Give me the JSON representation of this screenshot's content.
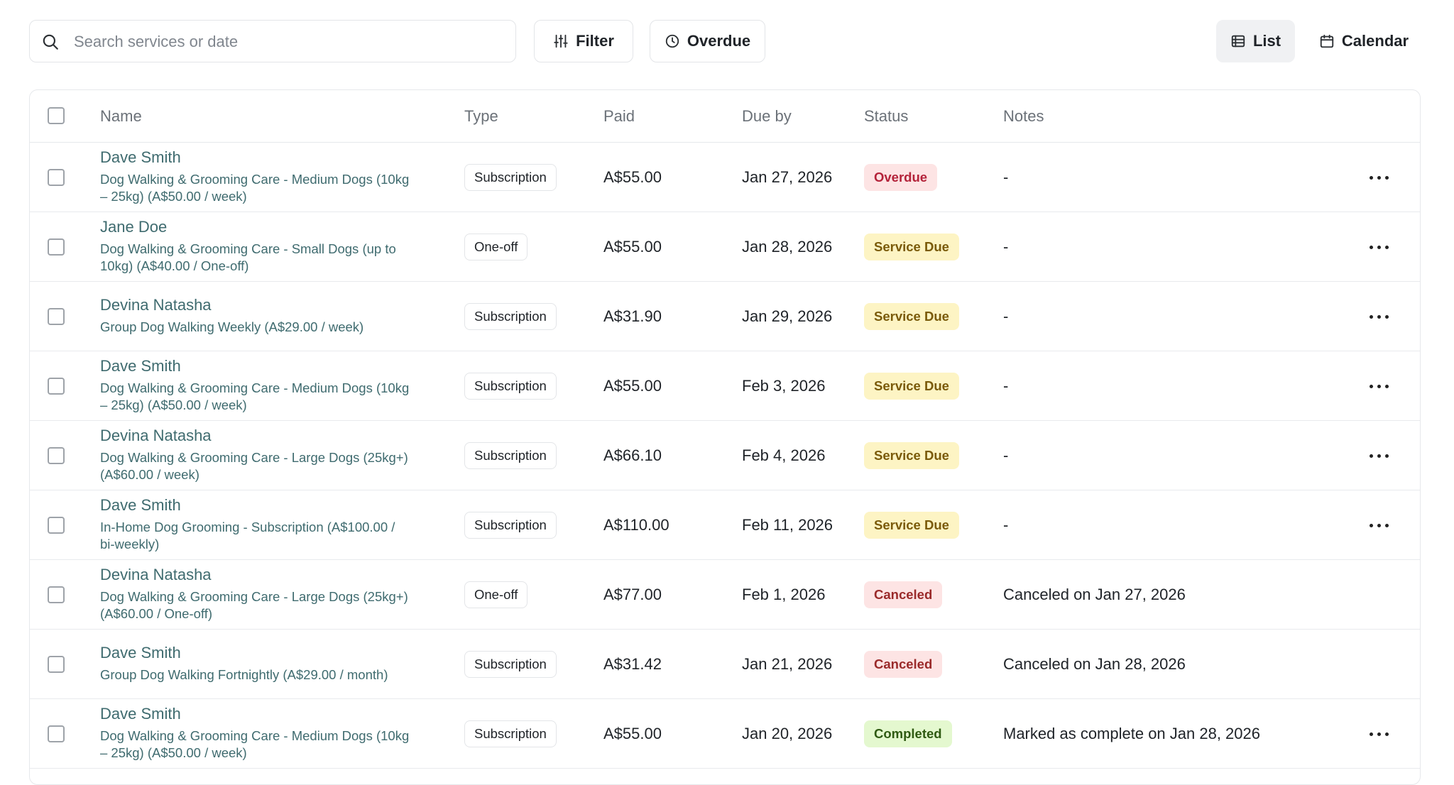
{
  "toolbar": {
    "search_placeholder": "Search services or date",
    "filter_label": "Filter",
    "overdue_label": "Overdue",
    "list_label": "List",
    "calendar_label": "Calendar"
  },
  "table": {
    "headers": {
      "name": "Name",
      "type": "Type",
      "paid": "Paid",
      "due_by": "Due by",
      "status": "Status",
      "notes": "Notes"
    },
    "rows": [
      {
        "name": "Dave Smith",
        "desc_lines": [
          "Dog Walking & Grooming Care - Medium Dogs (10kg",
          "– 25kg) (A$50.00 / week)"
        ],
        "type": "Subscription",
        "paid": "A$55.00",
        "due": "Jan 27, 2026",
        "status": "Overdue",
        "status_kind": "overdue",
        "notes": "-",
        "has_menu": true
      },
      {
        "name": "Jane Doe",
        "desc_lines": [
          "Dog Walking & Grooming Care - Small Dogs (up to",
          "10kg) (A$40.00 / One-off)"
        ],
        "type": "One-off",
        "paid": "A$55.00",
        "due": "Jan 28, 2026",
        "status": "Service Due",
        "status_kind": "due",
        "notes": "-",
        "has_menu": true
      },
      {
        "name": "Devina Natasha",
        "desc_lines": [
          "Group Dog Walking Weekly (A$29.00 / week)"
        ],
        "type": "Subscription",
        "paid": "A$31.90",
        "due": "Jan 29, 2026",
        "status": "Service Due",
        "status_kind": "due",
        "notes": "-",
        "has_menu": true
      },
      {
        "name": "Dave Smith",
        "desc_lines": [
          "Dog Walking & Grooming Care - Medium Dogs (10kg",
          "– 25kg) (A$50.00 / week)"
        ],
        "type": "Subscription",
        "paid": "A$55.00",
        "due": "Feb 3, 2026",
        "status": "Service Due",
        "status_kind": "due",
        "notes": "-",
        "has_menu": true
      },
      {
        "name": "Devina Natasha",
        "desc_lines": [
          "Dog Walking & Grooming Care - Large Dogs (25kg+)",
          "(A$60.00 / week)"
        ],
        "type": "Subscription",
        "paid": "A$66.10",
        "due": "Feb 4, 2026",
        "status": "Service Due",
        "status_kind": "due",
        "notes": "-",
        "has_menu": true
      },
      {
        "name": "Dave Smith",
        "desc_lines": [
          "In-Home Dog Grooming - Subscription (A$100.00 /",
          "bi-weekly)"
        ],
        "type": "Subscription",
        "paid": "A$110.00",
        "due": "Feb 11, 2026",
        "status": "Service Due",
        "status_kind": "due",
        "notes": "-",
        "has_menu": true
      },
      {
        "name": "Devina Natasha",
        "desc_lines": [
          "Dog Walking & Grooming Care - Large Dogs (25kg+)",
          "(A$60.00 / One-off)"
        ],
        "type": "One-off",
        "paid": "A$77.00",
        "due": "Feb 1, 2026",
        "status": "Canceled",
        "status_kind": "canceled",
        "notes": "Canceled on Jan 27, 2026",
        "has_menu": false
      },
      {
        "name": "Dave Smith",
        "desc_lines": [
          "Group Dog Walking Fortnightly (A$29.00 / month)"
        ],
        "type": "Subscription",
        "paid": "A$31.42",
        "due": "Jan 21, 2026",
        "status": "Canceled",
        "status_kind": "canceled",
        "notes": "Canceled on Jan 28, 2026",
        "has_menu": false
      },
      {
        "name": "Dave Smith",
        "desc_lines": [
          "Dog Walking & Grooming Care - Medium Dogs (10kg",
          "– 25kg) (A$50.00 / week)"
        ],
        "type": "Subscription",
        "paid": "A$55.00",
        "due": "Jan 20, 2026",
        "status": "Completed",
        "status_kind": "completed",
        "notes": "Marked as complete on Jan 28, 2026",
        "has_menu": true
      }
    ]
  },
  "colors": {
    "link_teal": "#3f6b6f",
    "status": {
      "overdue": {
        "bg": "#fde4e4",
        "fg": "#b4233a"
      },
      "due": {
        "bg": "#fdf4c4",
        "fg": "#7a5a09"
      },
      "canceled": {
        "bg": "#fde4e4",
        "fg": "#9a2a2a"
      },
      "completed": {
        "bg": "#e4f8cf",
        "fg": "#2f5a12"
      }
    }
  }
}
